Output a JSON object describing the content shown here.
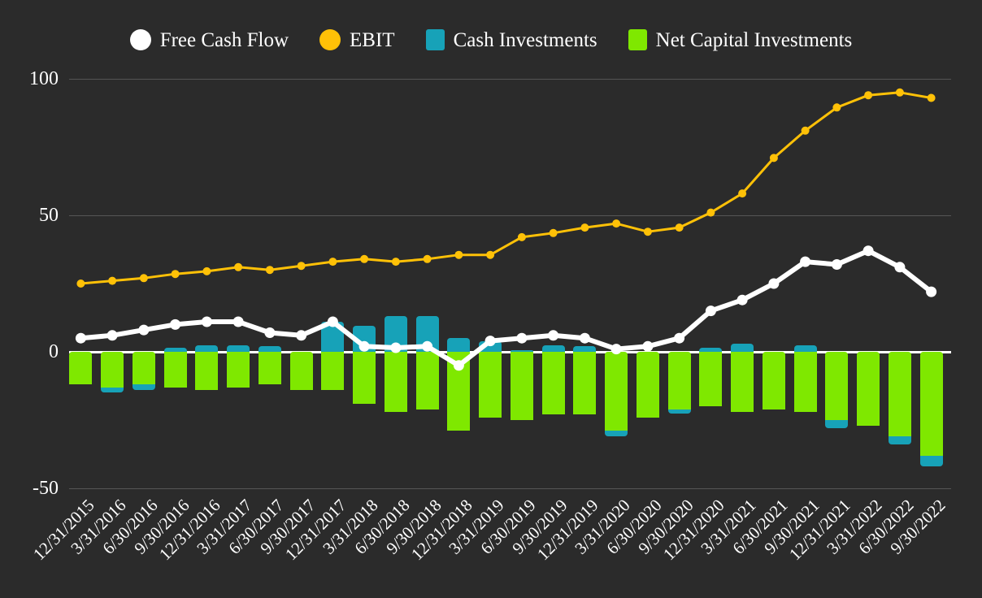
{
  "legend": {
    "items": [
      {
        "label": "Free Cash Flow",
        "color": "#ffffff",
        "marker": "circle",
        "name": "free-cash-flow"
      },
      {
        "label": "EBIT",
        "color": "#ffc107",
        "marker": "circle",
        "name": "ebit"
      },
      {
        "label": "Cash Investments",
        "color": "#17a2b8",
        "marker": "square",
        "name": "cash-investments"
      },
      {
        "label": "Net Capital Investments",
        "color": "#7fe800",
        "marker": "square",
        "name": "net-capital-investments"
      }
    ]
  },
  "axis": {
    "y_ticks": [
      "100",
      "50",
      "0",
      "-50"
    ],
    "y_values": [
      100,
      50,
      0,
      -50
    ]
  },
  "chart_data": {
    "type": "bar",
    "title": "",
    "xlabel": "",
    "ylabel": "",
    "ylim": [
      -50,
      100
    ],
    "grid": true,
    "legend_position": "top-center",
    "categories": [
      "12/31/2015",
      "3/31/2016",
      "6/30/2016",
      "9/30/2016",
      "12/31/2016",
      "3/31/2017",
      "6/30/2017",
      "9/30/2017",
      "12/31/2017",
      "3/31/2018",
      "6/30/2018",
      "9/30/2018",
      "12/31/2018",
      "3/31/2019",
      "6/30/2019",
      "9/30/2019",
      "12/31/2019",
      "3/31/2020",
      "6/30/2020",
      "9/30/2020",
      "12/31/2020",
      "3/31/2021",
      "6/30/2021",
      "9/30/2021",
      "12/31/2021",
      "3/31/2022",
      "6/30/2022",
      "9/30/2022"
    ],
    "series": [
      {
        "name": "Net Capital Investments",
        "type": "bar",
        "color": "#7fe800",
        "values": [
          -12,
          -13,
          -12,
          -13,
          -14,
          -13,
          -12,
          -14,
          -14,
          -19,
          -22,
          -21,
          -29,
          -24,
          -25,
          -23,
          -23,
          -29,
          -24,
          -21,
          -20,
          -22,
          -21,
          -22,
          -25,
          -27,
          -31,
          -38
        ]
      },
      {
        "name": "Cash Investments",
        "type": "bar",
        "color": "#17a2b8",
        "values": [
          0,
          -2,
          -2,
          1.5,
          2.5,
          2.5,
          2,
          0,
          11,
          9.5,
          13,
          13,
          5,
          4,
          0.5,
          2.5,
          2,
          -2,
          0,
          -1.5,
          1.5,
          3,
          0,
          2.5,
          -3,
          0,
          -3,
          -4
        ]
      },
      {
        "name": "Free Cash Flow",
        "type": "line",
        "color": "#ffffff",
        "values": [
          5,
          6,
          8,
          10,
          11,
          11,
          7,
          6,
          11,
          2,
          1.5,
          2,
          -5,
          4,
          5,
          6,
          5,
          1,
          2,
          5,
          15,
          19,
          25,
          33,
          32,
          37,
          31,
          22
        ]
      },
      {
        "name": "EBIT",
        "type": "line",
        "color": "#ffc107",
        "values": [
          25,
          26,
          27,
          28.5,
          29.5,
          31,
          30,
          31.5,
          33,
          34,
          33,
          34,
          35.5,
          35.5,
          42,
          43.5,
          45.5,
          47,
          44,
          45.5,
          51,
          58,
          71,
          81,
          89.5,
          94,
          95,
          93
        ]
      }
    ]
  }
}
